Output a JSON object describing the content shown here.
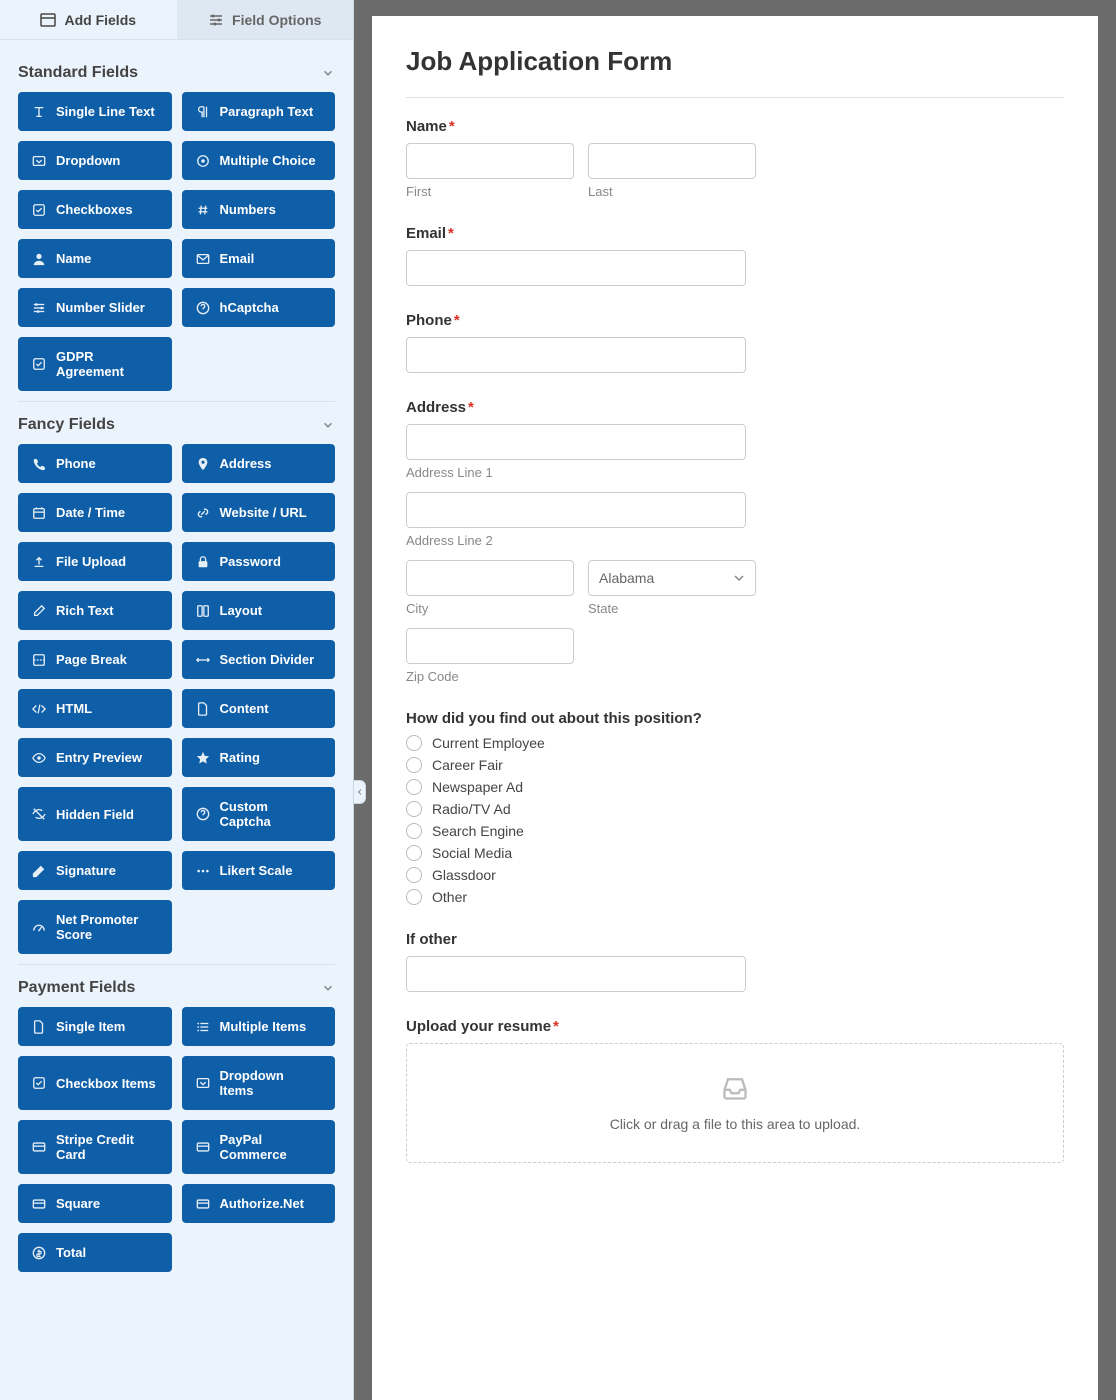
{
  "tabs": {
    "add_fields": "Add Fields",
    "field_options": "Field Options"
  },
  "sections": {
    "standard": {
      "title": "Standard Fields",
      "items": [
        {
          "label": "Single Line Text",
          "icon": "text",
          "slug": "single-line-text"
        },
        {
          "label": "Paragraph Text",
          "icon": "paragraph",
          "slug": "paragraph-text"
        },
        {
          "label": "Dropdown",
          "icon": "dropdown",
          "slug": "dropdown"
        },
        {
          "label": "Multiple Choice",
          "icon": "radio",
          "slug": "multiple-choice"
        },
        {
          "label": "Checkboxes",
          "icon": "check",
          "slug": "checkboxes"
        },
        {
          "label": "Numbers",
          "icon": "hash",
          "slug": "numbers"
        },
        {
          "label": "Name",
          "icon": "user",
          "slug": "name"
        },
        {
          "label": "Email",
          "icon": "mail",
          "slug": "email"
        },
        {
          "label": "Number Slider",
          "icon": "sliders",
          "slug": "number-slider"
        },
        {
          "label": "hCaptcha",
          "icon": "help",
          "slug": "hcaptcha"
        },
        {
          "label": "GDPR Agreement",
          "icon": "check",
          "slug": "gdpr-agreement"
        }
      ]
    },
    "fancy": {
      "title": "Fancy Fields",
      "items": [
        {
          "label": "Phone",
          "icon": "phone",
          "slug": "phone"
        },
        {
          "label": "Address",
          "icon": "pin",
          "slug": "address"
        },
        {
          "label": "Date / Time",
          "icon": "calendar",
          "slug": "date-time"
        },
        {
          "label": "Website / URL",
          "icon": "link",
          "slug": "website-url"
        },
        {
          "label": "File Upload",
          "icon": "upload",
          "slug": "file-upload"
        },
        {
          "label": "Password",
          "icon": "lock",
          "slug": "password"
        },
        {
          "label": "Rich Text",
          "icon": "edit",
          "slug": "rich-text"
        },
        {
          "label": "Layout",
          "icon": "columns",
          "slug": "layout"
        },
        {
          "label": "Page Break",
          "icon": "pagebreak",
          "slug": "page-break"
        },
        {
          "label": "Section Divider",
          "icon": "divider",
          "slug": "section-divider"
        },
        {
          "label": "HTML",
          "icon": "code",
          "slug": "html"
        },
        {
          "label": "Content",
          "icon": "file",
          "slug": "content"
        },
        {
          "label": "Entry Preview",
          "icon": "eye",
          "slug": "entry-preview"
        },
        {
          "label": "Rating",
          "icon": "star",
          "slug": "rating"
        },
        {
          "label": "Hidden Field",
          "icon": "eyeoff",
          "slug": "hidden-field"
        },
        {
          "label": "Custom Captcha",
          "icon": "help",
          "slug": "custom-captcha"
        },
        {
          "label": "Signature",
          "icon": "pencil",
          "slug": "signature"
        },
        {
          "label": "Likert Scale",
          "icon": "dots",
          "slug": "likert-scale"
        },
        {
          "label": "Net Promoter Score",
          "icon": "gauge",
          "slug": "net-promoter-score"
        }
      ]
    },
    "payment": {
      "title": "Payment Fields",
      "items": [
        {
          "label": "Single Item",
          "icon": "file",
          "slug": "single-item"
        },
        {
          "label": "Multiple Items",
          "icon": "list",
          "slug": "multiple-items"
        },
        {
          "label": "Checkbox Items",
          "icon": "check",
          "slug": "checkbox-items"
        },
        {
          "label": "Dropdown Items",
          "icon": "dropdown",
          "slug": "dropdown-items"
        },
        {
          "label": "Stripe Credit Card",
          "icon": "card",
          "slug": "stripe-credit-card"
        },
        {
          "label": "PayPal Commerce",
          "icon": "card",
          "slug": "paypal-commerce"
        },
        {
          "label": "Square",
          "icon": "card",
          "slug": "square"
        },
        {
          "label": "Authorize.Net",
          "icon": "card",
          "slug": "authorize-net"
        },
        {
          "label": "Total",
          "icon": "money",
          "slug": "total"
        }
      ]
    }
  },
  "form": {
    "title": "Job Application Form",
    "name": {
      "label": "Name",
      "required": true,
      "first_sub": "First",
      "last_sub": "Last"
    },
    "email": {
      "label": "Email",
      "required": true
    },
    "phone": {
      "label": "Phone",
      "required": true
    },
    "address": {
      "label": "Address",
      "required": true,
      "line1_sub": "Address Line 1",
      "line2_sub": "Address Line 2",
      "city_sub": "City",
      "state_sub": "State",
      "state_selected": "Alabama",
      "zip_sub": "Zip Code"
    },
    "source": {
      "label": "How did you find out about this position?",
      "options": [
        "Current Employee",
        "Career Fair",
        "Newspaper Ad",
        "Radio/TV Ad",
        "Search Engine",
        "Social Media",
        "Glassdoor",
        "Other"
      ]
    },
    "other": {
      "label": "If other"
    },
    "resume": {
      "label": "Upload your resume",
      "required": true,
      "hint": "Click or drag a file to this area to upload."
    }
  }
}
